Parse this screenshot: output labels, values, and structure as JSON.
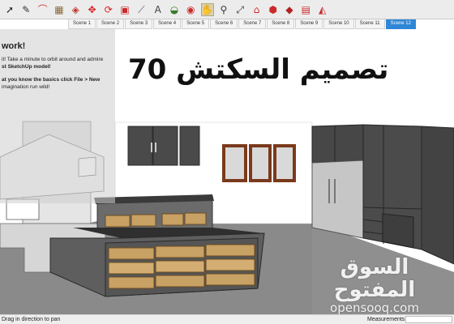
{
  "toolbar": {
    "tools": [
      {
        "name": "select-tool",
        "icon": "arrow-cursor-icon",
        "glyph": "➚",
        "color": "#222222"
      },
      {
        "name": "line-tool",
        "icon": "pencil-icon",
        "glyph": "✎",
        "color": "#333333"
      },
      {
        "name": "arc-tool",
        "icon": "arc-icon",
        "glyph": "⌒",
        "color": "#d23a3a"
      },
      {
        "name": "rectangle-tool",
        "icon": "rectangle-icon",
        "glyph": "▦",
        "color": "#8a6a3c"
      },
      {
        "name": "eraser-tool",
        "icon": "eraser-icon",
        "glyph": "◈",
        "color": "#c0392b"
      },
      {
        "name": "move-tool",
        "icon": "move-arrows-icon",
        "glyph": "✥",
        "color": "#d62020"
      },
      {
        "name": "rotate-tool",
        "icon": "rotate-icon",
        "glyph": "⟳",
        "color": "#d62020"
      },
      {
        "name": "scale-tool",
        "icon": "scale-icon",
        "glyph": "▣",
        "color": "#cc2a2a"
      },
      {
        "name": "tape-measure-tool",
        "icon": "tape-measure-icon",
        "glyph": "⟋",
        "color": "#555555"
      },
      {
        "name": "text-tool",
        "icon": "text-icon",
        "glyph": "A",
        "color": "#444444"
      },
      {
        "name": "paint-bucket-tool",
        "icon": "paint-bucket-icon",
        "glyph": "◒",
        "color": "#3b7a2a"
      },
      {
        "name": "orbit-tool",
        "icon": "orbit-icon",
        "glyph": "◉",
        "color": "#cc2a2a"
      },
      {
        "name": "pan-tool",
        "icon": "hand-icon",
        "glyph": "✋",
        "color": "#444444",
        "active": true
      },
      {
        "name": "zoom-tool",
        "icon": "magnifier-icon",
        "glyph": "⚲",
        "color": "#333333"
      },
      {
        "name": "zoom-extents-tool",
        "icon": "zoom-extents-icon",
        "glyph": "⤢",
        "color": "#333333"
      },
      {
        "name": "3d-warehouse-button",
        "icon": "warehouse-icon",
        "glyph": "⌂",
        "color": "#cc2a2a"
      },
      {
        "name": "extension-warehouse-button",
        "icon": "extension-icon",
        "glyph": "⬢",
        "color": "#cc2a2a"
      },
      {
        "name": "sketchup-extensions-button",
        "icon": "ruby-icon",
        "glyph": "◆",
        "color": "#b22222"
      },
      {
        "name": "layout-button",
        "icon": "layout-icon",
        "glyph": "▤",
        "color": "#cc2a2a"
      },
      {
        "name": "component-button",
        "icon": "component-icon",
        "glyph": "◭",
        "color": "#cc2a2a"
      }
    ]
  },
  "scenes": {
    "tabs": [
      "Scene 1",
      "Scene 2",
      "Scene 3",
      "Scene 4",
      "Scene 5",
      "Scene 6",
      "Scene 7",
      "Scene 8",
      "Scene 9",
      "Scene 10",
      "Scene 11",
      "Scene 12"
    ],
    "active_index": 11
  },
  "instructor": {
    "title": "work!",
    "lines": [
      "it! Take a minute to orbit around and admire",
      "st SketchUp model!",
      "",
      "at you know the basics click File > New",
      "imagination run wild!"
    ]
  },
  "overlay": {
    "arabic_title": "تصميم السكتش 70"
  },
  "watermark": {
    "arabic": "السوق المفتوح",
    "latin": "opensooq.com"
  },
  "statusbar": {
    "message": "Drag in direction to pan",
    "measurements_label": "Measurements"
  },
  "colors": {
    "scene_tab_active": "#2f86d6",
    "dark_cabinet": "#4a4a4a",
    "wood": "#c8a165",
    "window_frame": "#7a3a1c",
    "floor": "#8a8a8a"
  }
}
